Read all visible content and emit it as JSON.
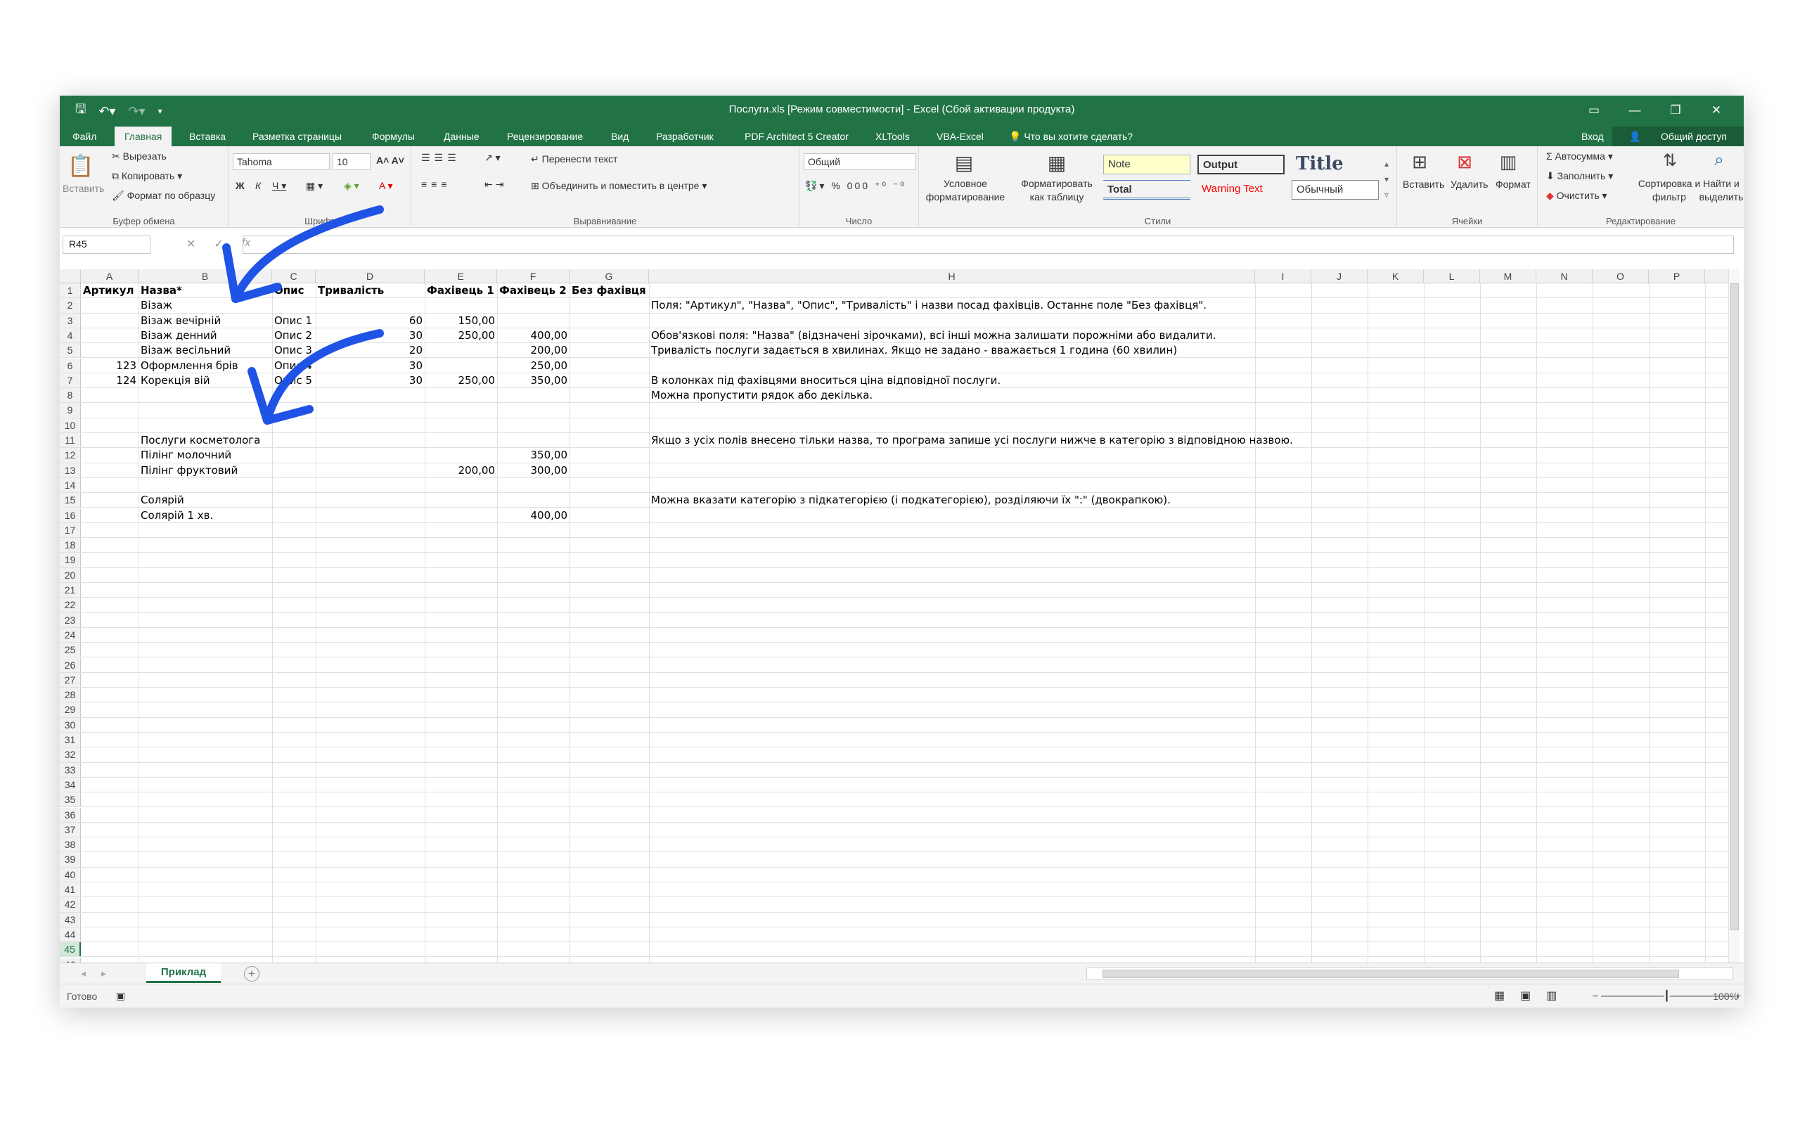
{
  "window": {
    "title": "Послуги.xls  [Режим совместимости] - Excel (Сбой активации продукта)"
  },
  "ribbon_tabs": [
    "Файл",
    "Главная",
    "Вставка",
    "Разметка страницы",
    "Формулы",
    "Данные",
    "Рецензирование",
    "Вид",
    "Разработчик",
    "PDF Architect 5 Creator",
    "XLTools",
    "VBA-Excel"
  ],
  "tell_me": "Что вы хотите сделать?",
  "signin": "Вход",
  "share": "Общий доступ",
  "clipboard": {
    "paste": "Вставить",
    "cut": "Вырезать",
    "copy": "Копировать",
    "format_painter": "Формат по образцу",
    "label": "Буфер обмена"
  },
  "font": {
    "name": "Tahoma",
    "size": "10",
    "label": "Шрифт"
  },
  "alignment": {
    "wrap": "Перенести текст",
    "merge": "Объединить и поместить в центре",
    "label": "Выравнивание"
  },
  "number": {
    "format": "Общий",
    "label": "Число"
  },
  "styles": {
    "conditional": "Условное форматирование",
    "as_table": "Форматировать как таблицу",
    "note": "Note",
    "output": "Output",
    "title": "Title",
    "total": "Total",
    "warning": "Warning Text",
    "normal": "Обычный",
    "label": "Стили"
  },
  "cells_grp": {
    "insert": "Вставить",
    "delete": "Удалить",
    "format": "Формат",
    "label": "Ячейки"
  },
  "editing": {
    "autosum": "Автосумма",
    "fill": "Заполнить",
    "clear": "Очистить",
    "sort": "Сортировка и фильтр",
    "find": "Найти и выделить",
    "label": "Редактирование"
  },
  "formula_bar": {
    "name_box": "R45",
    "fx": "fx"
  },
  "columns": [
    "A",
    "B",
    "C",
    "D",
    "E",
    "F",
    "G",
    "H",
    "I",
    "J",
    "K",
    "L",
    "M",
    "N",
    "O",
    "P"
  ],
  "rows_count": 46,
  "selected_row": 45,
  "sheet": {
    "r1": {
      "A": "Артикул",
      "B": "Назва*",
      "C": "Опис",
      "D": "Тривалість",
      "E": "Фахівець 1",
      "F": "Фахівець 2",
      "G": "Без фахівця"
    },
    "r2": {
      "B": "Візаж",
      "H": "Поля: \"Артикул\", \"Назва\", \"Опис\", \"Тривалість\" і назви посад фахівців. Останнє поле \"Без фахівця\"."
    },
    "r3": {
      "B": "Візаж вечірній",
      "C": "Опис 1",
      "D": "60",
      "E": "150,00"
    },
    "r4": {
      "B": "Візаж денний",
      "C": "Опис 2",
      "D": "30",
      "E": "250,00",
      "F": "400,00",
      "H": "Обов'язкові поля: \"Назва\" (відзначені зірочками), всі інші можна залишати порожніми або видалити."
    },
    "r5": {
      "B": "Візаж весільний",
      "C": "Опис 3",
      "D": "20",
      "F": "200,00",
      "H": "Тривалість послуги задається в хвилинах. Якщо не задано - вважається 1 година (60 хвилин)"
    },
    "r6": {
      "A": "123",
      "B": "Оформлення брів",
      "C": "Опис 4",
      "D": "30",
      "F": "250,00"
    },
    "r7": {
      "A": "124",
      "B": "Корекція вій",
      "C": "Опис 5",
      "D": "30",
      "E": "250,00",
      "F": "350,00",
      "H": "В колонках під фахівцями вноситься ціна відповідної послуги."
    },
    "r8": {
      "H": "Можна пропустити рядок або декілька."
    },
    "r11": {
      "B": "Послуги косметолога",
      "H": "Якщо з усіх полів внесено тільки назва, то програма запише усі послуги нижче в категорію з відповідною назвою."
    },
    "r12": {
      "B": "Пілінг молочний",
      "F": "350,00"
    },
    "r13": {
      "B": "Пілінг фруктовий",
      "E": "200,00",
      "F": "300,00"
    },
    "r15": {
      "B": "Солярій",
      "H": "Можна вказати категорію з підкатегорією (і подкатегорією), розділяючи їх \":\" (двокрапкою)."
    },
    "r16": {
      "B": "Солярій 1 хв.",
      "F": "400,00"
    }
  },
  "sheet_tab": "Приклад",
  "status": "Готово",
  "zoom": "100%"
}
